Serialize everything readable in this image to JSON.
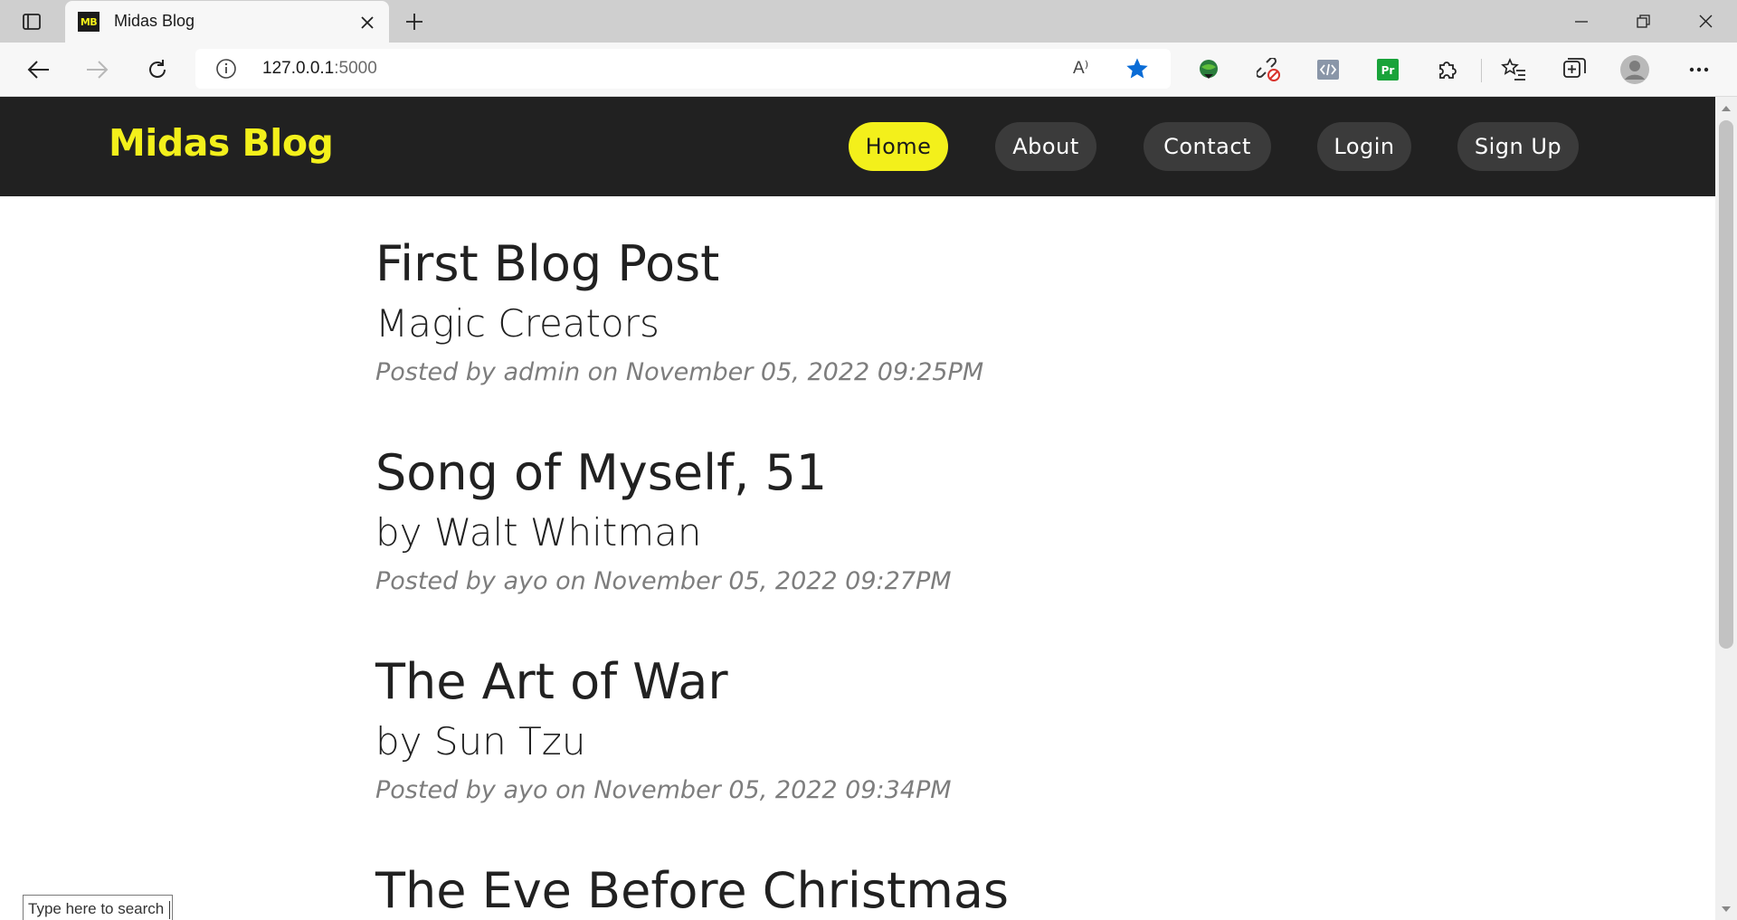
{
  "browser": {
    "tab": {
      "title": "Midas Blog",
      "favicon_text": "MB"
    },
    "address": {
      "host": "127.0.0.1",
      "port": ":5000"
    },
    "read_aloud_label": "A⁾"
  },
  "site": {
    "brand": "Midas Blog",
    "nav": [
      {
        "label": "Home",
        "active": true
      },
      {
        "label": "About",
        "active": false
      },
      {
        "label": "Contact",
        "active": false
      },
      {
        "label": "Login",
        "active": false
      },
      {
        "label": "Sign Up",
        "active": false
      }
    ]
  },
  "posts": [
    {
      "title": "First Blog Post",
      "subtitle": "Magic Creators",
      "meta": "Posted by admin on November 05, 2022 09:25PM"
    },
    {
      "title": "Song of Myself, 51",
      "subtitle": "by Walt Whitman",
      "meta": "Posted by ayo on November 05, 2022 09:27PM"
    },
    {
      "title": "The Art of War",
      "subtitle": "by Sun Tzu",
      "meta": "Posted by ayo on November 05, 2022 09:34PM"
    },
    {
      "title": "The Eve Before Christmas",
      "subtitle": "",
      "meta": ""
    }
  ],
  "taskbar": {
    "search_placeholder": "Type here to search"
  },
  "colors": {
    "brand": "#f3f01b",
    "nav_bg": "#212121",
    "pill_bg": "#3b3b3b",
    "favorite_star": "#0a6cd6"
  }
}
